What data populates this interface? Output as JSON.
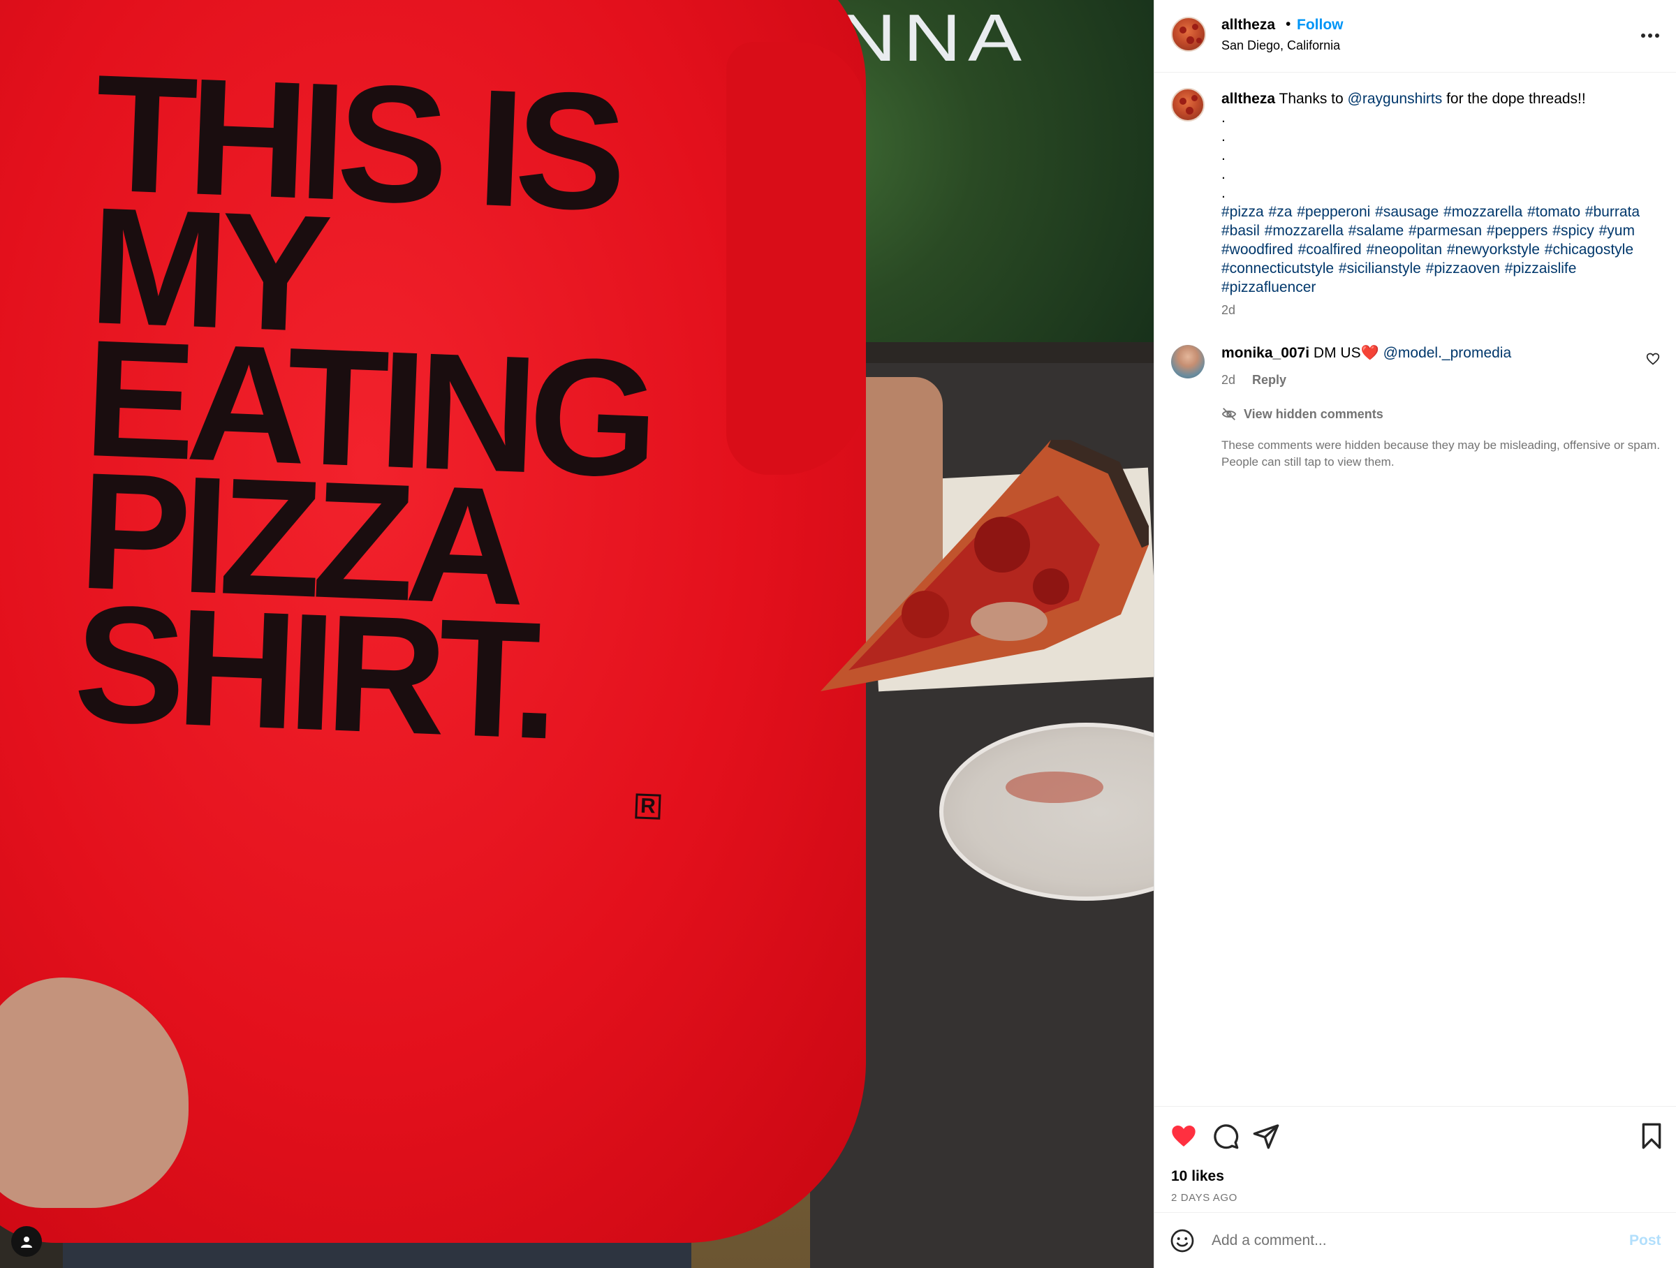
{
  "photo": {
    "shirt_lines": [
      "THIS IS",
      "MY",
      "EATING",
      "PIZZA",
      "SHIRT."
    ],
    "shirt_mark": "R",
    "sign_text": "WANNA"
  },
  "post": {
    "username": "alltheza",
    "dot": "•",
    "follow_label": "Follow",
    "location": "San Diego, California",
    "more_icon": "more-horizontal-icon"
  },
  "caption": {
    "username": "alltheza",
    "text_before": " Thanks to ",
    "mention": "@raygunshirts",
    "text_after": " for the dope threads!!",
    "dots": [
      ".",
      ".",
      ".",
      ".",
      "."
    ],
    "hashtags": "#pizza #za #pepperoni #sausage #mozzarella #tomato #burrata #basil #mozzarella #salame #parmesan #peppers #spicy #yum #woodfired #coalfired #neopolitan #newyorkstyle #chicagostyle #connecticutstyle #sicilianstyle #pizzaoven #pizzaislife #pizzafluencer",
    "time": "2d"
  },
  "comment": {
    "username": "monika_007i",
    "text": " DM US",
    "emoji": "❤️",
    "mention": "@model._promedia",
    "time": "2d",
    "reply_label": "Reply"
  },
  "hidden": {
    "label": "View hidden comments",
    "note": "These comments were hidden because they may be misleading, offensive or spam. People can still tap to view them."
  },
  "actions": {
    "likes": "10 likes",
    "date": "2 DAYS AGO",
    "like_color": "#ff3040"
  },
  "comment_bar": {
    "placeholder": "Add a comment...",
    "post_label": "Post"
  },
  "colors": {
    "link": "#00376b",
    "follow": "#0095f6",
    "muted": "#737373",
    "post_disabled": "#b2dffc"
  }
}
